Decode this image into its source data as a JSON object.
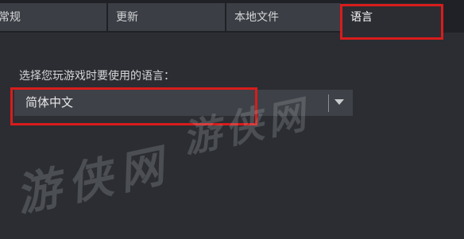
{
  "tabs": [
    {
      "label": "常规"
    },
    {
      "label": "更新"
    },
    {
      "label": "本地文件"
    },
    {
      "label": "语言",
      "active": true
    }
  ],
  "language_section": {
    "prompt": "选择您玩游戏时要使用的语言：",
    "selected_language": "简体中文",
    "dropdown_icon": "chevron-down-icon"
  },
  "watermark": {
    "text": "游侠网"
  },
  "colors": {
    "background": "#2b2d32",
    "tab_background": "#3b3e44",
    "highlight": "#d81c1c"
  }
}
